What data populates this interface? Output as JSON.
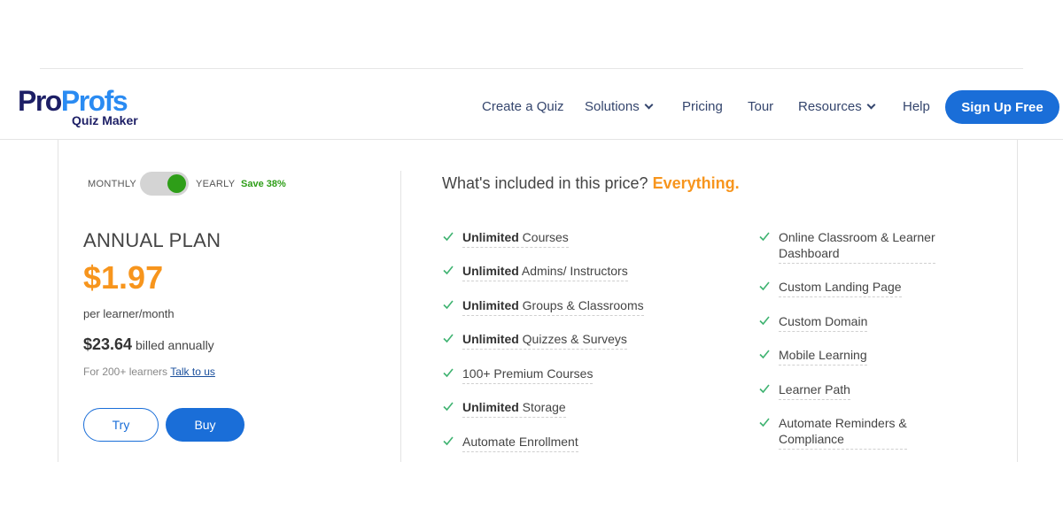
{
  "brand": {
    "logo_pro": "Pro",
    "logo_profs": "Profs",
    "logo_sub": "Quiz Maker"
  },
  "nav": {
    "items": [
      {
        "label": "Create a Quiz",
        "dropdown": false
      },
      {
        "label": "Solutions",
        "dropdown": true
      },
      {
        "label": "Pricing",
        "dropdown": false
      },
      {
        "label": "Tour",
        "dropdown": false
      },
      {
        "label": "Resources",
        "dropdown": true
      },
      {
        "label": "Help",
        "dropdown": false
      }
    ],
    "signup_label": "Sign Up Free"
  },
  "billing_toggle": {
    "monthly_label": "MONTHLY",
    "yearly_label": "YEARLY",
    "save_label": "Save 38%",
    "selected": "YEARLY"
  },
  "plan": {
    "name": "ANNUAL PLAN",
    "price": "$1.97",
    "per": "per learner/month",
    "billed_amount": "$23.64",
    "billed_text": "billed annually",
    "learners_text": "For 200+ learners",
    "talk_link": "Talk to us",
    "try_label": "Try",
    "buy_label": "Buy"
  },
  "included": {
    "heading": "What's included in this price?",
    "heading_accent": "Everything.",
    "left": [
      {
        "bold": "Unlimited",
        "rest": "Courses"
      },
      {
        "bold": "Unlimited",
        "rest": "Admins/ Instructors"
      },
      {
        "bold": "Unlimited",
        "rest": "Groups & Classrooms"
      },
      {
        "bold": "Unlimited",
        "rest": "Quizzes & Surveys"
      },
      {
        "bold": "",
        "rest": "100+ Premium Courses"
      },
      {
        "bold": "Unlimited",
        "rest": "Storage"
      },
      {
        "bold": "",
        "rest": "Automate Enrollment"
      }
    ],
    "right_lines": [
      [
        "Online Classroom & Learner",
        "Dashboard"
      ],
      [
        "Custom Landing Page"
      ],
      [
        "Custom Domain"
      ],
      [
        "Mobile Learning"
      ],
      [
        "Learner Path"
      ],
      [
        "Automate Reminders &",
        "Compliance"
      ]
    ]
  },
  "colors": {
    "primary": "#1a6ed8",
    "accent": "#f7951d",
    "success": "#2e9e18",
    "check": "#3fb371",
    "logo_dark": "#1d1f66",
    "logo_light": "#2a8bf2"
  }
}
